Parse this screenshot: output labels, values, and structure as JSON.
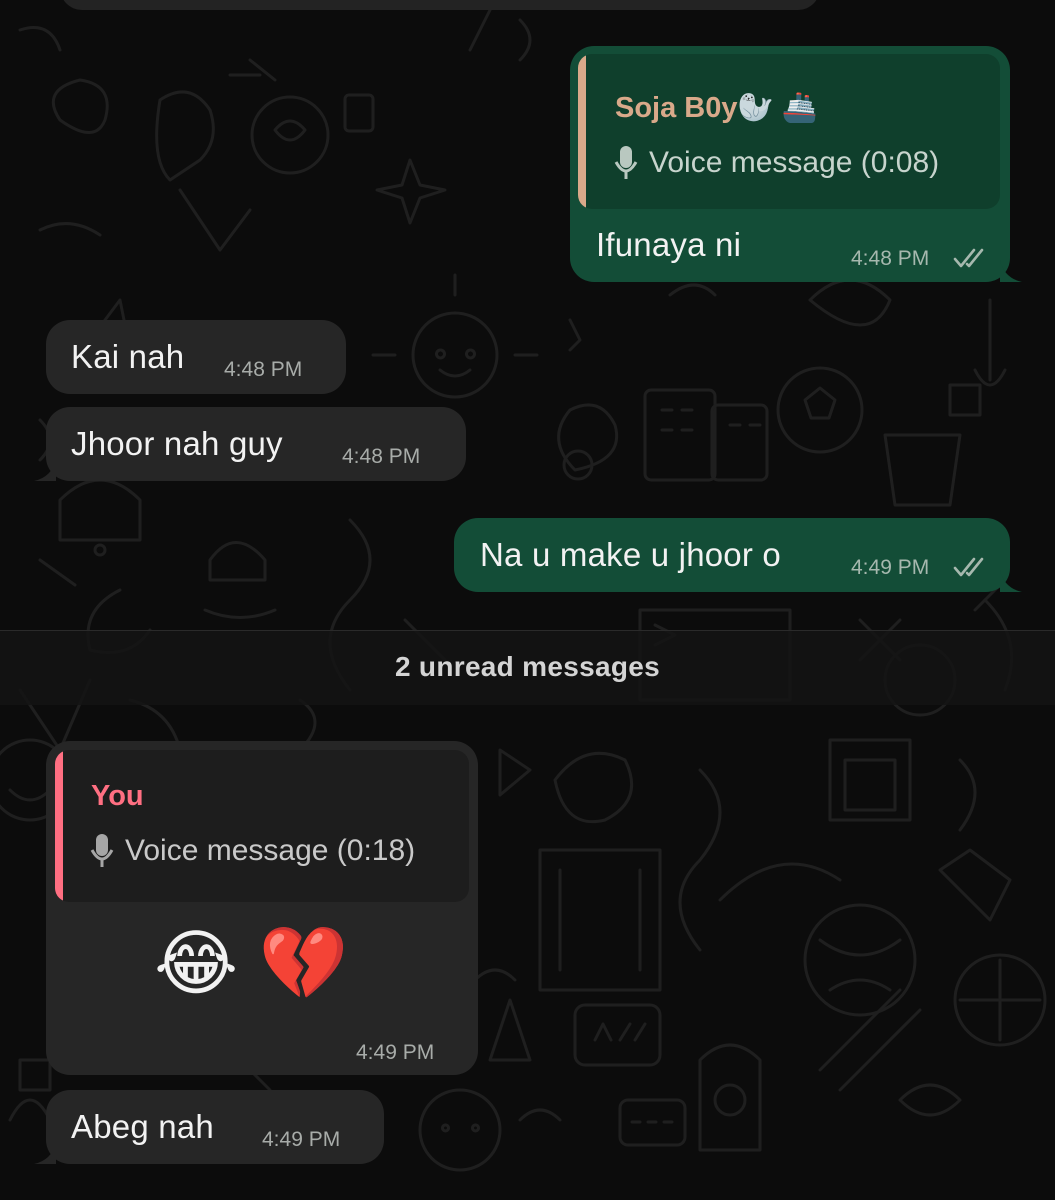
{
  "unread": {
    "label": "2 unread messages"
  },
  "messages": [
    {
      "direction": "out",
      "quote": {
        "author": "Soja B0y🦭 🚢",
        "content": "Voice message (0:08)"
      },
      "text": "Ifunaya ni",
      "time": "4:48 PM",
      "status": "read"
    },
    {
      "direction": "in",
      "text": "Kai nah",
      "time": "4:48 PM"
    },
    {
      "direction": "in",
      "text": "Jhoor nah guy",
      "time": "4:48 PM"
    },
    {
      "direction": "out",
      "text": "Na u make u jhoor o",
      "time": "4:49 PM",
      "status": "read"
    },
    {
      "direction": "in",
      "quote": {
        "author": "You",
        "content": "Voice message (0:18)"
      },
      "text": "😂 💔",
      "time": "4:49 PM"
    },
    {
      "direction": "in",
      "text": "Abeg nah",
      "time": "4:49 PM"
    }
  ],
  "colors": {
    "background": "#0c0c0c",
    "incoming_bubble": "#262626",
    "outgoing_bubble": "#134d37",
    "outgoing_quote_bg": "#0f3f2c",
    "incoming_quote_bg": "#1d1d1d",
    "quote_author_out": "#d9a98a",
    "quote_author_in": "#ff6f82",
    "timestamp": "#a8aca9"
  },
  "icons": [
    "microphone-icon",
    "double-check-icon"
  ]
}
